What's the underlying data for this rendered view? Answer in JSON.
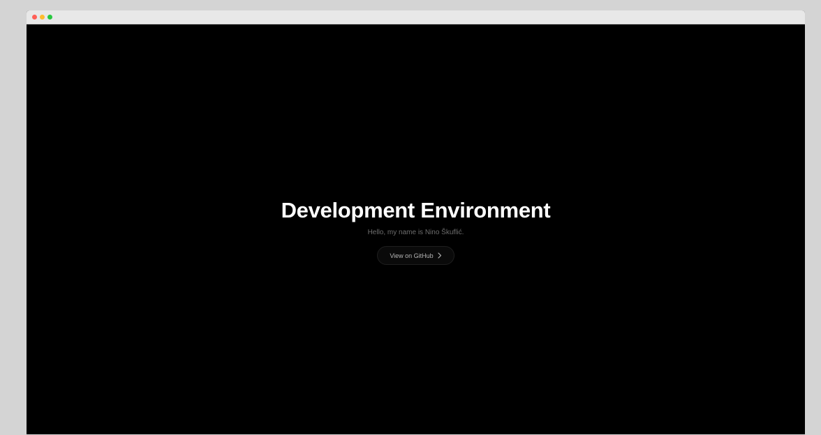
{
  "window": {
    "controls": {
      "close_color": "#ff5f57",
      "minimize_color": "#febc2e",
      "maximize_color": "#28c840"
    }
  },
  "hero": {
    "title": "Development Environment",
    "subtitle": "Hello, my name is Nino Škuflić.",
    "button_label": "View on GitHub",
    "button_icon": "chevron-right-icon"
  },
  "colors": {
    "page_background": "#000000",
    "title_color": "#ffffff",
    "subtitle_color": "#6e6e6e"
  }
}
